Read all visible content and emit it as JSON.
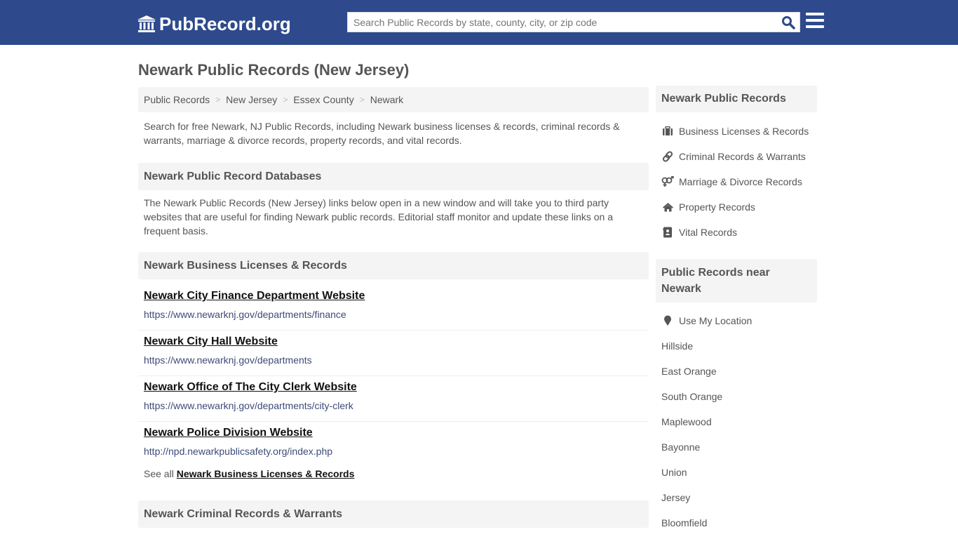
{
  "header": {
    "logo_text": "PubRecord.org",
    "search_placeholder": "Search Public Records by state, county, city, or zip code",
    "search_value": "",
    "colors": {
      "brand": "#2e4a8d",
      "search_icon": "#2e4a8d"
    }
  },
  "page": {
    "title": "Newark Public Records (New Jersey)"
  },
  "breadcrumb": [
    {
      "label": "Public Records"
    },
    {
      "label": "New Jersey"
    },
    {
      "label": "Essex County"
    },
    {
      "label": "Newark"
    }
  ],
  "breadcrumb_separator": ">",
  "intro": "Search for free Newark, NJ Public Records, including Newark business licenses & records, criminal records & warrants, marriage & divorce records, property records, and vital records.",
  "databases": {
    "heading": "Newark Public Record Databases",
    "description": "The Newark Public Records (New Jersey) links below open in a new window and will take you to third party websites that are useful for finding Newark public records. Editorial staff monitor and update these links on a frequent basis."
  },
  "business": {
    "heading": "Newark Business Licenses & Records",
    "links": [
      {
        "title": "Newark City Finance Department Website",
        "url": "https://www.newarknj.gov/departments/finance"
      },
      {
        "title": "Newark City Hall Website",
        "url": "https://www.newarknj.gov/departments"
      },
      {
        "title": "Newark Office of The City Clerk Website",
        "url": "https://www.newarknj.gov/departments/city-clerk"
      },
      {
        "title": "Newark Police Division Website",
        "url": "http://npd.newarkpublicsafety.org/index.php"
      }
    ],
    "see_all_prefix": "See all",
    "see_all_link": "Newark Business Licenses & Records"
  },
  "criminal": {
    "heading": "Newark Criminal Records & Warrants"
  },
  "sidebar": {
    "records_heading": "Newark Public Records",
    "records_items": [
      {
        "label": "Business Licenses & Records",
        "icon": "briefcase-icon"
      },
      {
        "label": "Criminal Records & Warrants",
        "icon": "link-icon"
      },
      {
        "label": "Marriage & Divorce Records",
        "icon": "gender-icon"
      },
      {
        "label": "Property Records",
        "icon": "home-icon"
      },
      {
        "label": "Vital Records",
        "icon": "address-book-icon"
      }
    ],
    "nearby_heading": "Public Records near Newark",
    "use_location": {
      "label": "Use My Location",
      "icon": "map-marker-icon"
    },
    "nearby_cities": [
      "Hillside",
      "East Orange",
      "South Orange",
      "Maplewood",
      "Bayonne",
      "Union",
      "Jersey",
      "Bloomfield"
    ]
  }
}
